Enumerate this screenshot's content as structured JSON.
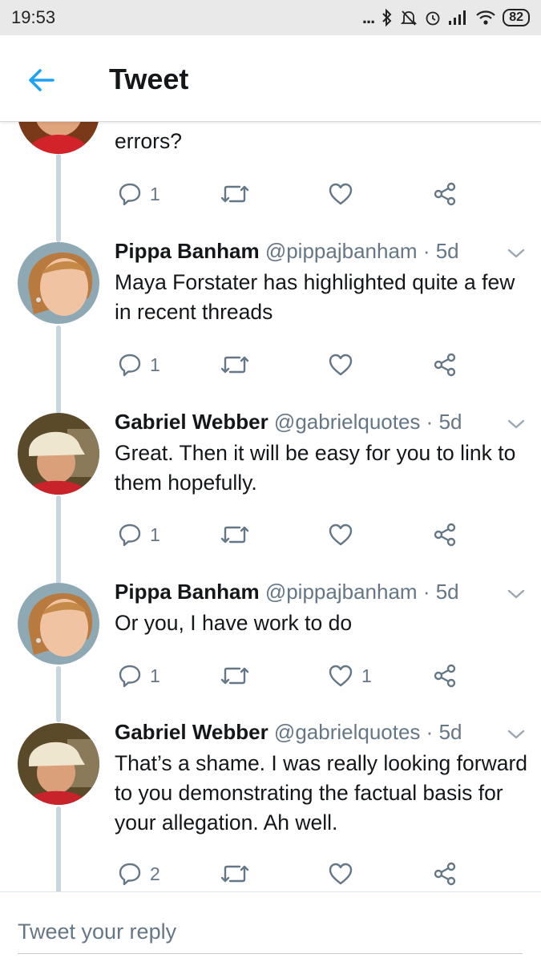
{
  "status_bar": {
    "time": "19:53",
    "battery": "82",
    "dots": "..."
  },
  "header": {
    "title": "Tweet",
    "back_icon": "arrow-left-icon"
  },
  "accent_color": "#1da1f2",
  "previous_tweet": {
    "text_tail": "errors?",
    "reply_count": "1",
    "like_count": ""
  },
  "tweets": [
    {
      "name": "Pippa Banham",
      "handle": "@pippajbanham",
      "time": "5d",
      "text": "Maya Forstater has highlighted quite a few in recent threads",
      "reply_count": "1",
      "like_count": ""
    },
    {
      "name": "Gabriel Webber",
      "handle": "@gabrielquotes",
      "time": "5d",
      "text": "Great. Then it will be easy for you to link to them hopefully.",
      "reply_count": "1",
      "like_count": ""
    },
    {
      "name": "Pippa Banham",
      "handle": "@pippajbanham",
      "time": "5d",
      "text": "Or you, I have work to do",
      "reply_count": "1",
      "like_count": "1"
    },
    {
      "name": "Gabriel Webber",
      "handle": "@gabrielquotes",
      "time": "5d",
      "text": "That’s a shame. I was really looking forward to you demonstrating the factual basis for your allegation. Ah well.",
      "reply_count": "2",
      "like_count": ""
    }
  ],
  "separator": "·",
  "reply": {
    "placeholder": "Tweet your reply"
  }
}
